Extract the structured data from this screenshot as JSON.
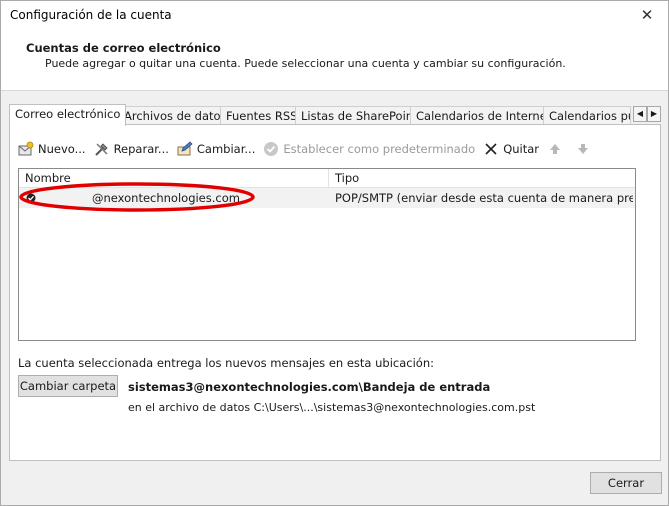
{
  "window": {
    "title": "Configuración de la cuenta",
    "close_glyph": "✕"
  },
  "header": {
    "heading": "Cuentas de correo electrónico",
    "description": "Puede agregar o quitar una cuenta. Puede seleccionar una cuenta y cambiar su configuración."
  },
  "tabs": [
    {
      "label": "Correo electrónico",
      "active": true
    },
    {
      "label": "Archivos de datos"
    },
    {
      "label": "Fuentes RSS"
    },
    {
      "label": "Listas de SharePoint"
    },
    {
      "label": "Calendarios de Internet"
    },
    {
      "label": "Calendarios pul"
    }
  ],
  "tab_scroll": {
    "left": "◀",
    "right": "▶"
  },
  "toolbar": {
    "new": "Nuevo...",
    "repair": "Reparar...",
    "change": "Cambiar...",
    "set_default": "Establecer como predeterminado",
    "remove": "Quitar"
  },
  "accounts": {
    "columns": [
      "Nombre",
      "Tipo"
    ],
    "rows": [
      {
        "name": "@nexontechnologies.com",
        "type": "POP/SMTP (enviar desde esta cuenta de manera predete..."
      }
    ]
  },
  "delivery": {
    "label": "La cuenta seleccionada entrega los nuevos mensajes en esta ubicación:",
    "change_folder": "Cambiar carpeta",
    "folder": "sistemas3@nexontechnologies.com\\Bandeja de entrada",
    "path": "en el archivo de datos C:\\Users\\...\\sistemas3@nexontechnologies.com.pst"
  },
  "footer": {
    "close": "Cerrar"
  },
  "colors": {
    "annotation": "#e00000",
    "window_bg": "#f0f0f0"
  }
}
